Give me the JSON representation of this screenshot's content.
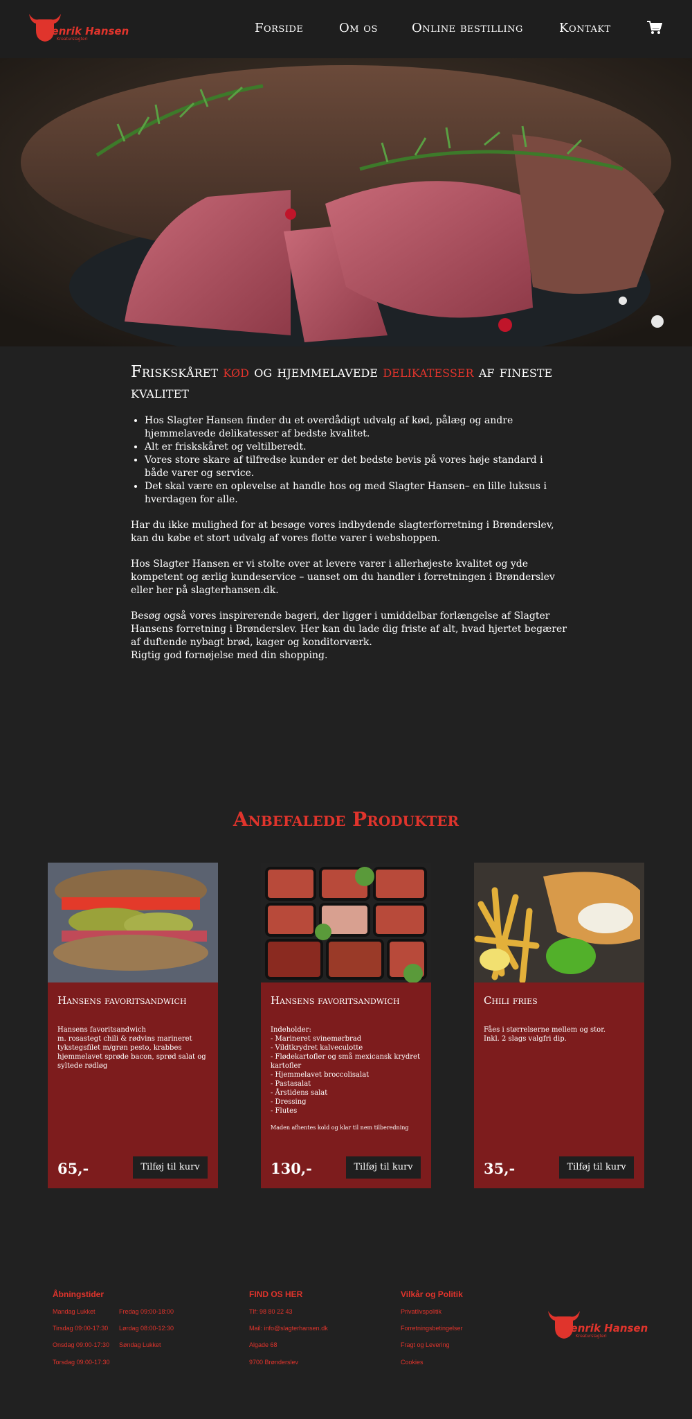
{
  "header": {
    "logo_name": "Henrik Hansen",
    "logo_sub": "Kreaturslagteri",
    "nav": [
      "Forside",
      "Om os",
      "Online bestilling",
      "Kontakt"
    ],
    "cart_icon": "shopping-cart-icon"
  },
  "intro": {
    "title_part1": "Friskskåret",
    "title_red1": "kød",
    "title_part2": "og hjemmelavede",
    "title_red2": "delikatesser",
    "title_part3": "af fineste kvalitet",
    "bullets": [
      "Hos Slagter Hansen finder du et overdådigt udvalg af kød, pålæg og andre hjemmelavede delikatesser af bedste kvalitet.",
      "Alt er friskskåret og veltilberedt.",
      "Vores store skare af tilfredse kunder er det bedste bevis på vores høje standard i både varer og service.",
      "Det skal være en oplevelse at handle hos og med Slagter Hansen– en lille luksus i hverdagen for alle."
    ],
    "p1": "Har du ikke mulighed for at besøge vores indbydende slagterforretning i Brønderslev, kan du købe et stort udvalg af vores flotte varer i webshoppen.",
    "p2": "Hos Slagter Hansen er vi stolte over at levere varer i allerhøjeste kvalitet og yde kompetent og ærlig kundeservice – uanset om du handler i forretningen i Brønderslev eller her på slagterhansen.dk.",
    "p3": "Besøg også vores inspirerende bageri, der ligger i umiddelbar forlængelse af Slagter Hansens forretning i Brønderslev. Her kan du lade dig friste af alt, hvad hjertet begærer af duftende nybagt brød, kager og konditorværk.",
    "p4": "Rigtig god fornøjelse med din shopping."
  },
  "products": {
    "section_title": "Anbefalede Produkter",
    "button_label": "Tilføj til kurv",
    "items": [
      {
        "title": "Hansens favoritsandwich",
        "desc": "Hansens favoritsandwich\nm. rosastegt chili & rødvins marineret tykstegsfilet m/grøn pesto, krabbes hjemmelavet sprøde bacon, sprød salat og syltede rødløg",
        "note": "",
        "price": "65,-"
      },
      {
        "title": "Hansens favoritsandwich",
        "desc": "Indeholder:\n- Marineret svinemørbrad\n- Vildtkrydret kalveculotte\n- Flødekartofler og små mexicansk krydret kartofler\n- Hjemmelavet broccolisalat\n- Pastasalat\n- Årstidens salat\n- Dressing\n- Flutes",
        "note": "Maden afhentes kold og klar til nem tilberedning",
        "price": "130,-"
      },
      {
        "title": "Chili fries",
        "desc": "Fåes i størrelserne mellem og stor.\nInkl. 2 slags valgfri dip.",
        "note": "",
        "price": "35,-"
      }
    ]
  },
  "footer": {
    "hours_title": "Åbningstider",
    "hours": [
      "Mandag Lukket",
      "Tirsdag  09:00-17:30",
      "Onsdag 09:00-17:30",
      "Torsdag 09:00-17:30",
      "Fredag  09:00-18:00",
      "Lørdag 08:00-12:30",
      "Søndag Lukket"
    ],
    "find_title": "FIND OS HER",
    "find": [
      "Tlf: 98 80 22 43",
      "Mail: info@slagterhansen.dk",
      "Algade 68",
      "9700 Brønderslev"
    ],
    "policy_title": "Vilkår og Politik",
    "policy": [
      "Privatlivspolitik",
      "Forretningsbetingelser",
      "Fragt og Levering",
      "Cookies"
    ]
  },
  "colors": {
    "accent": "#e0342c",
    "background": "#212121",
    "card": "#7d1c1d"
  }
}
